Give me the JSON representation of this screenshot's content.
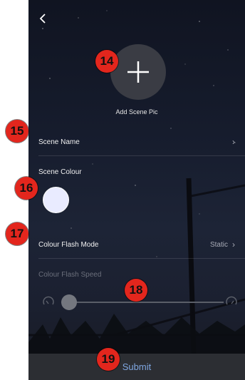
{
  "header": {
    "back_icon": "back-chevron-icon"
  },
  "scene_pic": {
    "icon": "plus-icon",
    "label": "Add Scene Pic"
  },
  "scene_name": {
    "label": "Scene Name",
    "icon": "chevron-right-icon"
  },
  "scene_colour": {
    "label": "Scene Colour",
    "swatch_color": "#e9ebff"
  },
  "flash_mode": {
    "label": "Colour Flash Mode",
    "value": "Static",
    "icon": "chevron-right-icon"
  },
  "flash_speed": {
    "label": "Colour Flash Speed",
    "slow_icon": "speed-slow-icon",
    "fast_icon": "speed-fast-icon",
    "level": 0.05
  },
  "footer": {
    "submit_label": "Submit",
    "accent_color": "#7fa6e0"
  },
  "annotations": [
    "14",
    "15",
    "16",
    "17",
    "18",
    "19"
  ]
}
